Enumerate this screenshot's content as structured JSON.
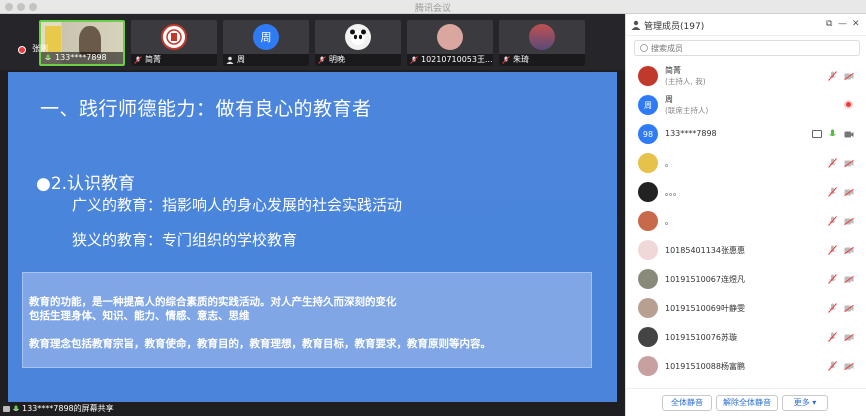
{
  "window": {
    "title": "腾讯会议"
  },
  "video_strip": {
    "active_speaker": "张刚",
    "tiles": [
      {
        "name": "133****7898",
        "avatar_text": "",
        "avatar_color": "#8a7a5a",
        "active": true
      },
      {
        "name": "简菁",
        "avatar_text": "",
        "avatar_color": "#c0392b",
        "active": false
      },
      {
        "name": "周",
        "avatar_text": "周",
        "avatar_color": "#2f7bf5",
        "active": false
      },
      {
        "name": "明晚",
        "avatar_text": "",
        "avatar_color": "#eeeeee",
        "active": false
      },
      {
        "name": "10210710053王...",
        "avatar_text": "",
        "avatar_color": "#d9a7a0",
        "active": false
      },
      {
        "name": "朱琦",
        "avatar_text": "",
        "avatar_color": "#7a5a8a",
        "active": false
      }
    ]
  },
  "slide": {
    "heading": "一、践行师德能力：做有良心的教育者",
    "subheading": "●2.认识教育",
    "line1": "广义的教育：指影响人的身心发展的社会实践活动",
    "line2": "狭义的教育：专门组织的学校教育",
    "box_line1": "教育的功能，是一种提高人的综合素质的实践活动。对人产生持久而深刻的变化",
    "box_line2": "包括生理身体、知识、能力、情感、意志、思维",
    "box_line3": "教育理念包括教育宗旨，教育使命，教育目的，教育理想，教育目标，教育要求，教育原则等内容。"
  },
  "sharing": {
    "label": "133****7898的屏幕共享"
  },
  "panel": {
    "title": "管理成员(197)",
    "search_placeholder": "搜索成员",
    "members": [
      {
        "name": "简菁",
        "role": "(主持人, 我)",
        "avatar_text": "",
        "avatar_color": "#c0392b",
        "status": "muted"
      },
      {
        "name": "周",
        "role": "(联席主持人)",
        "avatar_text": "周",
        "avatar_color": "#2f7bf5",
        "status": "recording"
      },
      {
        "name": "133****7898",
        "role": "",
        "avatar_text": "98",
        "avatar_color": "#2f7bf5",
        "status": "speaking"
      },
      {
        "name": "。",
        "role": "",
        "avatar_text": "",
        "avatar_color": "#e6c24a",
        "status": "muted"
      },
      {
        "name": "。。。",
        "role": "",
        "avatar_text": "",
        "avatar_color": "#222222",
        "status": "muted"
      },
      {
        "name": "。",
        "role": "",
        "avatar_text": "",
        "avatar_color": "#c86a4a",
        "status": "muted"
      },
      {
        "name": "10185401134张惠惠",
        "role": "",
        "avatar_text": "",
        "avatar_color": "#f0d8d8",
        "status": "muted"
      },
      {
        "name": "10191510067连煜凡",
        "role": "",
        "avatar_text": "",
        "avatar_color": "#8a8a7a",
        "status": "muted"
      },
      {
        "name": "10191510069叶静雯",
        "role": "",
        "avatar_text": "",
        "avatar_color": "#b8a090",
        "status": "muted"
      },
      {
        "name": "10191510076苏璇",
        "role": "",
        "avatar_text": "",
        "avatar_color": "#444444",
        "status": "muted"
      },
      {
        "name": "10191510088杨富鹏",
        "role": "",
        "avatar_text": "",
        "avatar_color": "#c9a0a0",
        "status": "muted"
      }
    ],
    "footer": {
      "mute_all": "全体静音",
      "unmute_all": "解除全体静音",
      "more": "更多 ▾"
    }
  }
}
